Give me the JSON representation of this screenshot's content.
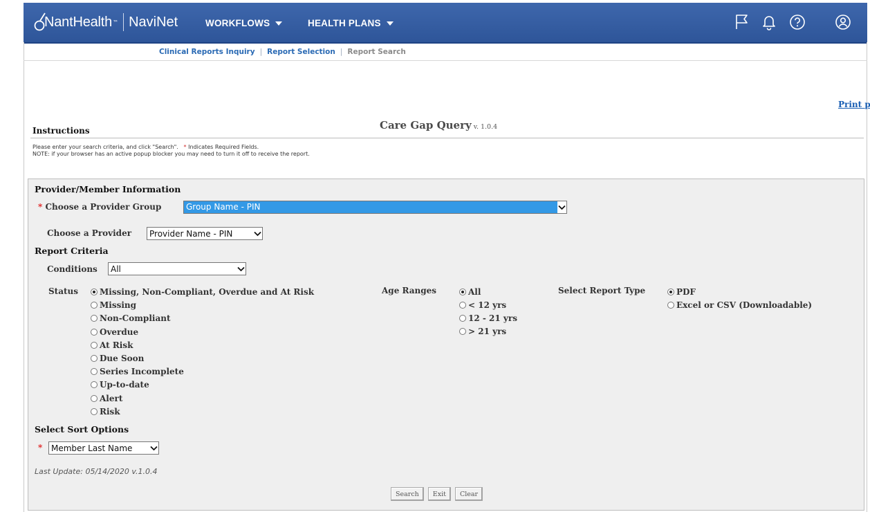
{
  "header": {
    "brand_name": "NantHealth",
    "brand_product": "NaviNet",
    "nav": [
      {
        "label": "WORKFLOWS"
      },
      {
        "label": "HEALTH PLANS"
      }
    ],
    "icons": [
      "flag-icon",
      "bell-icon",
      "help-icon",
      "user-account-icon"
    ],
    "colors": {
      "bar": "#2e5599",
      "text": "#ffffff"
    }
  },
  "breadcrumb": {
    "items": [
      "Clinical Reports Inquiry",
      "Report Selection",
      "Report Search"
    ]
  },
  "print_link": "Print page",
  "page": {
    "title": "Care Gap Query",
    "version": "v. 1.0.4"
  },
  "instructions": {
    "heading": "Instructions",
    "line1_a": "Please enter your search criteria, and click \"Search\".",
    "line1_star": "*",
    "line1_b": "Indicates Required Fields.",
    "line2": "NOTE: if your browser has an active popup blocker you may need to turn it off to receive the report."
  },
  "form": {
    "section_provider": "Provider/Member Information",
    "required_star": "*",
    "provider_group_label": "Choose a Provider Group",
    "provider_group_value": "Group Name - PIN",
    "provider_label": "Choose a Provider",
    "provider_value": "Provider Name - PIN",
    "section_criteria": "Report Criteria",
    "conditions_label": "Conditions",
    "conditions_value": "All",
    "status_label": "Status",
    "status_options": [
      {
        "label": "Missing, Non-Compliant, Overdue and At Risk",
        "selected": true
      },
      {
        "label": "Missing",
        "selected": false
      },
      {
        "label": "Non-Compliant",
        "selected": false
      },
      {
        "label": "Overdue",
        "selected": false
      },
      {
        "label": "At Risk",
        "selected": false
      },
      {
        "label": "Due Soon",
        "selected": false
      },
      {
        "label": "Series Incomplete",
        "selected": false
      },
      {
        "label": "Up-to-date",
        "selected": false
      },
      {
        "label": "Alert",
        "selected": false
      },
      {
        "label": "Risk",
        "selected": false
      }
    ],
    "age_label": "Age Ranges",
    "age_options": [
      {
        "label": "All",
        "selected": true
      },
      {
        "label": "< 12 yrs",
        "selected": false
      },
      {
        "label": "12 - 21 yrs",
        "selected": false
      },
      {
        "label": "> 21 yrs",
        "selected": false
      }
    ],
    "report_type_label": "Select Report Type",
    "report_type_options": [
      {
        "label": "PDF",
        "selected": true
      },
      {
        "label": "Excel or CSV (Downloadable)",
        "selected": false
      }
    ],
    "section_sort": "Select Sort Options",
    "sort_value": "Member Last Name",
    "last_update": "Last Update: 05/14/2020 v.1.0.4",
    "buttons": {
      "search": "Search",
      "exit": "Exit",
      "clear": "Clear"
    }
  }
}
